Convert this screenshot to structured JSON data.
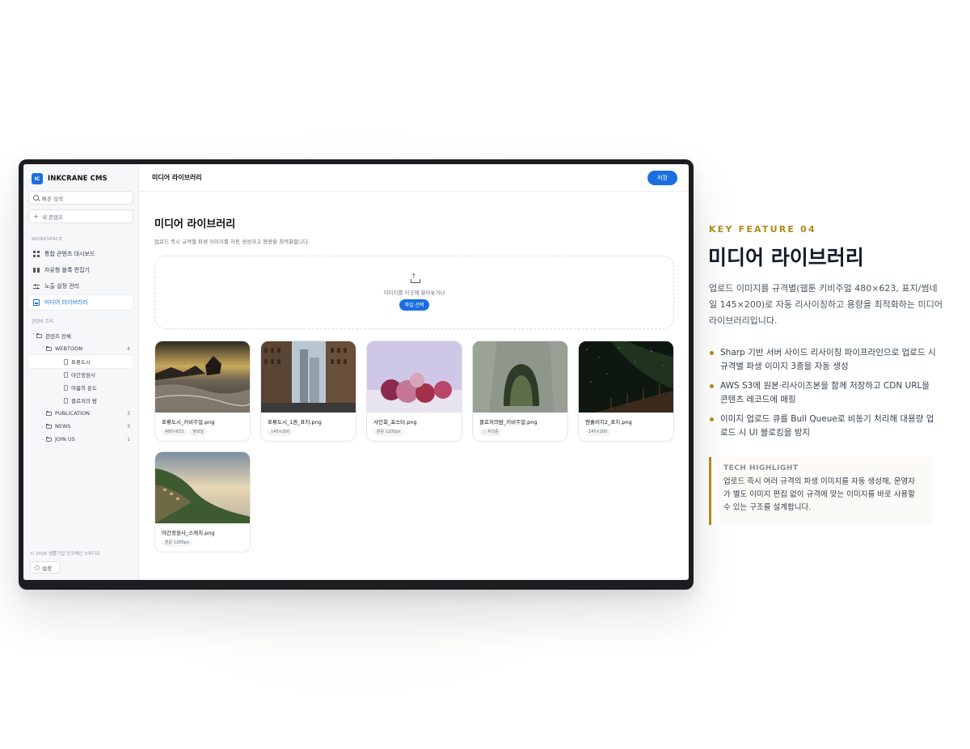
{
  "app": {
    "brand_logo": "IC",
    "brand_name": "INKCRANE CMS",
    "search_placeholder": "빠른 검색",
    "new_content_label": "새 콘텐츠",
    "accent_color": "#1a6fe0",
    "gold_color": "#b08a1a"
  },
  "sidebar": {
    "workspace_label": "WORKSPACE",
    "nav": [
      {
        "label": "통합 콘텐츠 대시보드",
        "icon": "grid-icon"
      },
      {
        "label": "자유형 블록 편집기",
        "icon": "blocks-icon"
      },
      {
        "label": "노출 설정 관리",
        "icon": "sliders-icon"
      },
      {
        "label": "미디어 라이브러리",
        "icon": "image-icon",
        "active": true
      }
    ],
    "tree_label": "콘텐츠 트리",
    "tree": {
      "root": "콘텐츠 전체",
      "webtoon": {
        "label": "WEBTOON",
        "count": "4"
      },
      "webtoon_items": [
        "표류도시",
        "야간정원사",
        "여름의 온도",
        "클로저의 밤"
      ],
      "publication": {
        "label": "PUBLICATION",
        "count": "3"
      },
      "news": {
        "label": "NEWS",
        "count": "3"
      },
      "joinus": {
        "label": "JOIN US",
        "count": "1"
      }
    },
    "copyright": "© 2026 생플기업 인크레인 스튜디오",
    "settings_label": "설정"
  },
  "topbar": {
    "title": "미디어 라이브러리",
    "save_label": "저장"
  },
  "main": {
    "title": "미디어 라이브러리",
    "description": "업로드 즉시 규격별 파생 이미지를 자동 생성하고 용량을 최적화합니다.",
    "drop_text": "이미지를 이곳에 끌어놓거나",
    "file_button": "파일 선택"
  },
  "media": [
    {
      "name": "표류도시_키비주얼.png",
      "tags": [
        "480×623",
        "썸네일"
      ]
    },
    {
      "name": "표류도시_1권_표지.png",
      "tags": [
        "145×200"
      ]
    },
    {
      "name": "사인회_포스터.png",
      "tags": [
        "본문 1200px"
      ]
    },
    {
      "name": "클로저의밤_키비주얼.png",
      "tags": [
        "처리중"
      ]
    },
    {
      "name": "엔솔러지2_표지.png",
      "tags": [
        "145×200"
      ]
    },
    {
      "name": "야간정원사_스케치.png",
      "tags": [
        "본문 1200px"
      ]
    }
  ],
  "feature": {
    "label": "KEY FEATURE 04",
    "title": "미디어 라이브러리",
    "description": "업로드 이미지를 규격별(웹툰 키비주얼 480×623, 표지/썸네일 145×200)로 자동 리사이징하고 용량을 최적화하는 미디어 라이브러리입니다.",
    "bullets": [
      "Sharp 기반 서버 사이드 리사이징 파이프라인으로 업로드 시 규격별 파생 이미지 3종을 자동 생성",
      "AWS S3에 원본·리사이즈본을 함께 저장하고 CDN URL을 콘텐츠 레코드에 매핑",
      "이미지 업로드 큐를 Bull Queue로 비동기 처리해 대용량 업로드 시 UI 블로킹을 방지"
    ],
    "tech_title": "TECH HIGHLIGHT",
    "tech_text": "업로드 즉시 여러 규격의 파생 이미지를 자동 생성해, 운영자가 별도 이미지 편집 없이 규격에 맞는 이미지를 바로 사용할 수 있는 구조를 설계합니다."
  }
}
